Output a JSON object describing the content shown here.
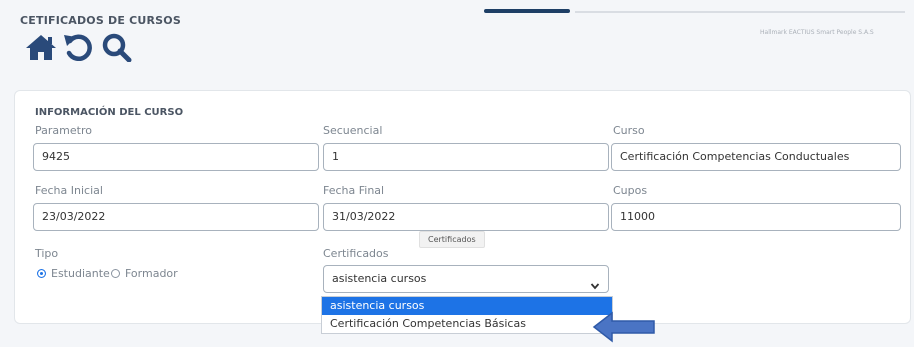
{
  "header": {
    "title": "CETIFICADOS DE CURSOS",
    "meta_text": "Hallmark EACTIUS Smart People S.A.S"
  },
  "icons": [
    "home-icon",
    "undo-icon",
    "search-icon"
  ],
  "course_info": {
    "section_title": "INFORMACIÓN DEL CURSO",
    "parametro": {
      "label": "Parametro",
      "value": "9425"
    },
    "secuencial": {
      "label": "Secuencial",
      "value": "1"
    },
    "curso": {
      "label": "Curso",
      "value": "Certificación Competencias Conductuales"
    },
    "fecha_inicial": {
      "label": "Fecha Inicial",
      "value": "23/03/2022"
    },
    "fecha_final": {
      "label": "Fecha Final",
      "value": "31/03/2022"
    },
    "cupos": {
      "label": "Cupos",
      "value": "11000"
    },
    "tipo": {
      "label": "Tipo",
      "options": [
        {
          "label": "Estudiante",
          "selected": true
        },
        {
          "label": "Formador",
          "selected": false
        }
      ]
    },
    "certificados": {
      "label": "Certificados",
      "tooltip": "Certificados",
      "selected": "asistencia cursos",
      "options": [
        "asistencia cursos",
        "Certificación Competencias Básicas"
      ]
    }
  },
  "colors": {
    "accent": "#1d73e6",
    "icon": "#2a4a7a",
    "arrow": "#4a74c4"
  }
}
